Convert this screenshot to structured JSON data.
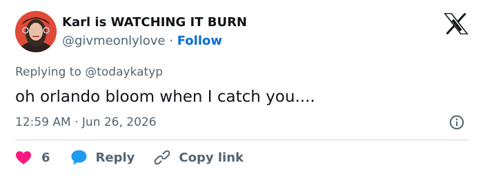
{
  "author": {
    "display_name": "Karl is WATCHING IT BURN",
    "handle": "@givmeonlylove",
    "separator": "·",
    "follow_label": "Follow",
    "avatar_icon": "user-avatar-photo"
  },
  "reply_context": {
    "text": "Replying to @todaykatyp"
  },
  "tweet": {
    "text": "oh orlando bloom when I catch you....",
    "timestamp": "12:59 AM · Jun 26, 2026"
  },
  "actions": {
    "like_count": "6",
    "reply_label": "Reply",
    "copy_link_label": "Copy link"
  },
  "colors": {
    "text": "#0f1419",
    "secondary": "#536471",
    "link": "#006fd6",
    "like": "#f91880",
    "reply": "#1d9bf0",
    "divider": "#cfd9de"
  },
  "icons": {
    "logo": "x-logo-icon",
    "info": "info-icon",
    "like": "heart-icon",
    "reply": "speech-bubble-icon",
    "copy": "link-icon"
  }
}
